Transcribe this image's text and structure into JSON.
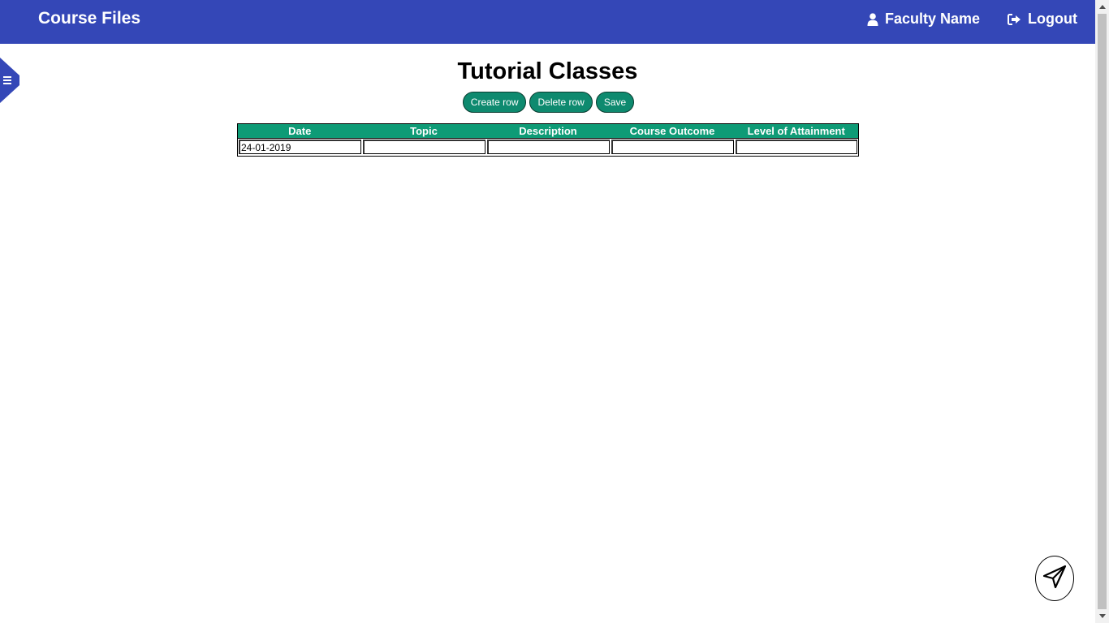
{
  "header": {
    "brand": "Course Files",
    "user_label": "Faculty Name",
    "logout_label": "Logout"
  },
  "main": {
    "title": "Tutorial Classes",
    "buttons": {
      "create_row": "Create row",
      "delete_row": "Delete row",
      "save": "Save"
    },
    "table": {
      "columns": [
        "Date",
        "Topic",
        "Description",
        "Course Outcome",
        "Level of Attainment"
      ],
      "rows": [
        [
          "24-01-2019",
          "",
          "",
          "",
          ""
        ]
      ]
    }
  },
  "colors": {
    "navbar": "#3447b7",
    "accent_green": "#0e8a6f",
    "table_header": "#0e9b76"
  },
  "icons": {
    "user": "user-icon",
    "logout": "logout-icon",
    "menu": "hamburger-menu-icon",
    "send": "paper-plane-icon"
  }
}
